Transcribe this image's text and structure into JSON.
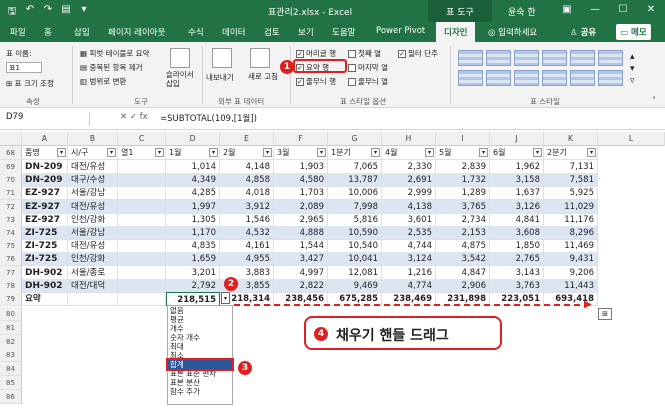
{
  "window": {
    "title": "표관리2.xlsx - Excel",
    "context_tab": "표 도구",
    "user": "윤숙 한",
    "qat_icons": [
      "save-icon",
      "undo-icon",
      "redo-icon",
      "format-icon",
      "customize-icon"
    ]
  },
  "tabs": [
    "파일",
    "홈",
    "삽입",
    "페이지 레이아웃",
    "수식",
    "데이터",
    "검토",
    "보기",
    "도움말",
    "Power Pivot",
    "디자인"
  ],
  "active_tab": "디자인",
  "tell_me": "입력하세요",
  "share": "공유",
  "memo": "메모",
  "ribbon": {
    "props_label": "표 이름:",
    "table_name": "표1",
    "resize": "표 크기 조정",
    "group_props": "속성",
    "tools": [
      "피벗 테이블로 요약",
      "중복된 항목 제거",
      "범위로 변환"
    ],
    "slicer": "슬라이서 삽입",
    "group_tools": "도구",
    "export": "내보내기",
    "refresh": "새로 고침",
    "group_external": "외부 표 데이터",
    "options": [
      {
        "label": "머리글 행",
        "checked": true
      },
      {
        "label": "첫째 열",
        "checked": false
      },
      {
        "label": "필터 단추",
        "checked": true
      },
      {
        "label": "요약 행",
        "checked": true
      },
      {
        "label": "마지막 열",
        "checked": false
      },
      {
        "label": "줄무늬 행",
        "checked": true
      },
      {
        "label": "줄무늬 열",
        "checked": false
      }
    ],
    "group_options": "표 스타일 옵션",
    "group_styles": "표 스타일"
  },
  "formula_bar": {
    "cell_ref": "D79",
    "formula": "=SUBTOTAL(109,[1월])"
  },
  "columns": [
    "A",
    "B",
    "C",
    "D",
    "E",
    "F",
    "G",
    "H",
    "I",
    "J",
    "K",
    "L"
  ],
  "headers": [
    "품명",
    "시/구",
    "열1",
    "1월",
    "2월",
    "3월",
    "1분기",
    "4월",
    "5월",
    "6월",
    "2분기"
  ],
  "rows": [
    {
      "num": "69",
      "code": "DN-209",
      "region": "대전/유성",
      "v": [
        "1,014",
        "4,148",
        "1,903",
        "7,065",
        "2,330",
        "2,839",
        "1,962",
        "7,131"
      ]
    },
    {
      "num": "70",
      "code": "DN-209",
      "region": "대구/수성",
      "v": [
        "4,349",
        "4,858",
        "4,580",
        "13,787",
        "2,691",
        "1,732",
        "3,158",
        "7,581"
      ]
    },
    {
      "num": "71",
      "code": "EZ-927",
      "region": "서울/강남",
      "v": [
        "4,285",
        "4,018",
        "1,703",
        "10,006",
        "2,999",
        "1,289",
        "1,637",
        "5,925"
      ]
    },
    {
      "num": "72",
      "code": "EZ-927",
      "region": "대전/유성",
      "v": [
        "1,997",
        "3,912",
        "2,089",
        "7,998",
        "4,138",
        "3,765",
        "3,126",
        "11,029"
      ]
    },
    {
      "num": "73",
      "code": "EZ-927",
      "region": "인천/강화",
      "v": [
        "1,305",
        "1,546",
        "2,965",
        "5,816",
        "3,601",
        "2,734",
        "4,841",
        "11,176"
      ]
    },
    {
      "num": "74",
      "code": "ZI-725",
      "region": "서울/강남",
      "v": [
        "1,170",
        "4,532",
        "4,888",
        "10,590",
        "2,535",
        "2,153",
        "3,608",
        "8,296"
      ]
    },
    {
      "num": "75",
      "code": "ZI-725",
      "region": "대전/유성",
      "v": [
        "4,835",
        "4,161",
        "1,544",
        "10,540",
        "4,744",
        "4,875",
        "1,850",
        "11,469"
      ]
    },
    {
      "num": "76",
      "code": "ZI-725",
      "region": "인천/강화",
      "v": [
        "1,659",
        "4,955",
        "3,427",
        "10,041",
        "3,124",
        "3,542",
        "2,765",
        "9,431"
      ]
    },
    {
      "num": "77",
      "code": "DH-902",
      "region": "서울/종로",
      "v": [
        "3,201",
        "3,883",
        "4,997",
        "12,081",
        "1,216",
        "4,847",
        "3,143",
        "9,206"
      ]
    },
    {
      "num": "78",
      "code": "DH-902",
      "region": "대전/대덕",
      "v": [
        "2,792",
        "3,855",
        "2,822",
        "9,469",
        "4,774",
        "2,906",
        "3,763",
        "11,443"
      ]
    }
  ],
  "summary": {
    "num": "79",
    "label": "요약",
    "v": [
      "218,515",
      "218,314",
      "238,456",
      "675,285",
      "238,469",
      "231,898",
      "223,051",
      "693,418"
    ]
  },
  "empty_rows": [
    "80",
    "81",
    "82",
    "83",
    "84",
    "85",
    "86"
  ],
  "dropdown": [
    "없음",
    "평균",
    "개수",
    "숫자 개수",
    "최대",
    "최소",
    "합계",
    "표본 표준 편차",
    "표본 분산",
    "함수 추가"
  ],
  "dropdown_selected": "합계",
  "markers": [
    "1",
    "2",
    "3",
    "4"
  ],
  "callout": "채우기 핸들 드래그"
}
